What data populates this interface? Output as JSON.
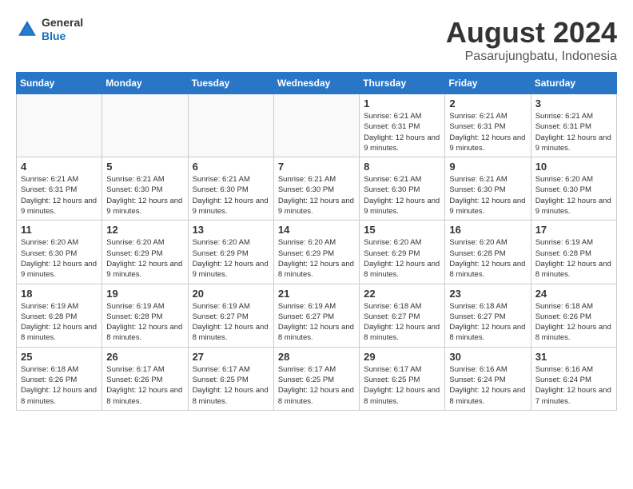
{
  "header": {
    "logo_general": "General",
    "logo_blue": "Blue",
    "title": "August 2024",
    "subtitle": "Pasarujungbatu, Indonesia"
  },
  "days_of_week": [
    "Sunday",
    "Monday",
    "Tuesday",
    "Wednesday",
    "Thursday",
    "Friday",
    "Saturday"
  ],
  "weeks": [
    [
      {
        "day": "",
        "info": ""
      },
      {
        "day": "",
        "info": ""
      },
      {
        "day": "",
        "info": ""
      },
      {
        "day": "",
        "info": ""
      },
      {
        "day": "1",
        "info": "Sunrise: 6:21 AM\nSunset: 6:31 PM\nDaylight: 12 hours and 9 minutes."
      },
      {
        "day": "2",
        "info": "Sunrise: 6:21 AM\nSunset: 6:31 PM\nDaylight: 12 hours and 9 minutes."
      },
      {
        "day": "3",
        "info": "Sunrise: 6:21 AM\nSunset: 6:31 PM\nDaylight: 12 hours and 9 minutes."
      }
    ],
    [
      {
        "day": "4",
        "info": "Sunrise: 6:21 AM\nSunset: 6:31 PM\nDaylight: 12 hours and 9 minutes."
      },
      {
        "day": "5",
        "info": "Sunrise: 6:21 AM\nSunset: 6:30 PM\nDaylight: 12 hours and 9 minutes."
      },
      {
        "day": "6",
        "info": "Sunrise: 6:21 AM\nSunset: 6:30 PM\nDaylight: 12 hours and 9 minutes."
      },
      {
        "day": "7",
        "info": "Sunrise: 6:21 AM\nSunset: 6:30 PM\nDaylight: 12 hours and 9 minutes."
      },
      {
        "day": "8",
        "info": "Sunrise: 6:21 AM\nSunset: 6:30 PM\nDaylight: 12 hours and 9 minutes."
      },
      {
        "day": "9",
        "info": "Sunrise: 6:21 AM\nSunset: 6:30 PM\nDaylight: 12 hours and 9 minutes."
      },
      {
        "day": "10",
        "info": "Sunrise: 6:20 AM\nSunset: 6:30 PM\nDaylight: 12 hours and 9 minutes."
      }
    ],
    [
      {
        "day": "11",
        "info": "Sunrise: 6:20 AM\nSunset: 6:30 PM\nDaylight: 12 hours and 9 minutes."
      },
      {
        "day": "12",
        "info": "Sunrise: 6:20 AM\nSunset: 6:29 PM\nDaylight: 12 hours and 9 minutes."
      },
      {
        "day": "13",
        "info": "Sunrise: 6:20 AM\nSunset: 6:29 PM\nDaylight: 12 hours and 9 minutes."
      },
      {
        "day": "14",
        "info": "Sunrise: 6:20 AM\nSunset: 6:29 PM\nDaylight: 12 hours and 8 minutes."
      },
      {
        "day": "15",
        "info": "Sunrise: 6:20 AM\nSunset: 6:29 PM\nDaylight: 12 hours and 8 minutes."
      },
      {
        "day": "16",
        "info": "Sunrise: 6:20 AM\nSunset: 6:28 PM\nDaylight: 12 hours and 8 minutes."
      },
      {
        "day": "17",
        "info": "Sunrise: 6:19 AM\nSunset: 6:28 PM\nDaylight: 12 hours and 8 minutes."
      }
    ],
    [
      {
        "day": "18",
        "info": "Sunrise: 6:19 AM\nSunset: 6:28 PM\nDaylight: 12 hours and 8 minutes."
      },
      {
        "day": "19",
        "info": "Sunrise: 6:19 AM\nSunset: 6:28 PM\nDaylight: 12 hours and 8 minutes."
      },
      {
        "day": "20",
        "info": "Sunrise: 6:19 AM\nSunset: 6:27 PM\nDaylight: 12 hours and 8 minutes."
      },
      {
        "day": "21",
        "info": "Sunrise: 6:19 AM\nSunset: 6:27 PM\nDaylight: 12 hours and 8 minutes."
      },
      {
        "day": "22",
        "info": "Sunrise: 6:18 AM\nSunset: 6:27 PM\nDaylight: 12 hours and 8 minutes."
      },
      {
        "day": "23",
        "info": "Sunrise: 6:18 AM\nSunset: 6:27 PM\nDaylight: 12 hours and 8 minutes."
      },
      {
        "day": "24",
        "info": "Sunrise: 6:18 AM\nSunset: 6:26 PM\nDaylight: 12 hours and 8 minutes."
      }
    ],
    [
      {
        "day": "25",
        "info": "Sunrise: 6:18 AM\nSunset: 6:26 PM\nDaylight: 12 hours and 8 minutes."
      },
      {
        "day": "26",
        "info": "Sunrise: 6:17 AM\nSunset: 6:26 PM\nDaylight: 12 hours and 8 minutes."
      },
      {
        "day": "27",
        "info": "Sunrise: 6:17 AM\nSunset: 6:25 PM\nDaylight: 12 hours and 8 minutes."
      },
      {
        "day": "28",
        "info": "Sunrise: 6:17 AM\nSunset: 6:25 PM\nDaylight: 12 hours and 8 minutes."
      },
      {
        "day": "29",
        "info": "Sunrise: 6:17 AM\nSunset: 6:25 PM\nDaylight: 12 hours and 8 minutes."
      },
      {
        "day": "30",
        "info": "Sunrise: 6:16 AM\nSunset: 6:24 PM\nDaylight: 12 hours and 8 minutes."
      },
      {
        "day": "31",
        "info": "Sunrise: 6:16 AM\nSunset: 6:24 PM\nDaylight: 12 hours and 7 minutes."
      }
    ]
  ]
}
